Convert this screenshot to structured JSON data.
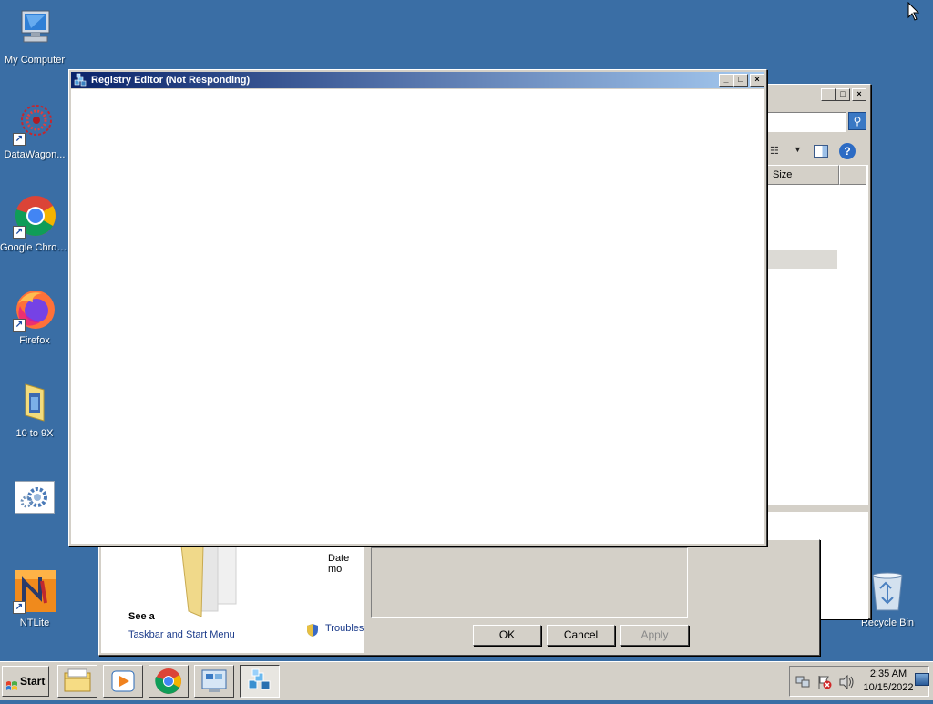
{
  "desktop": {
    "icons": [
      {
        "label": "My Computer"
      },
      {
        "label": "DataWagon..."
      },
      {
        "label": "Google Chrome"
      },
      {
        "label": "Firefox"
      },
      {
        "label": "10 to 9X"
      },
      {
        "label": ""
      },
      {
        "label": "NTLite"
      },
      {
        "label": "Recycle Bin"
      }
    ]
  },
  "regedit": {
    "title": "Registry Editor (Not Responding)"
  },
  "explorer": {
    "column_size": "Size"
  },
  "properties": {
    "date_modified": "Date mo",
    "see_also": "See a",
    "taskbar_link": "Taskbar and Start Menu",
    "troubleshoot": "Troubles",
    "ok": "OK",
    "cancel": "Cancel",
    "apply": "Apply"
  },
  "taskbar": {
    "start": "Start",
    "time": "2:35 AM",
    "date": "10/15/2022"
  },
  "colors": {
    "desktop": "#3a6ea5",
    "title_active_start": "#0a246a",
    "title_active_end": "#a6caf0",
    "face": "#d4d0c8"
  }
}
